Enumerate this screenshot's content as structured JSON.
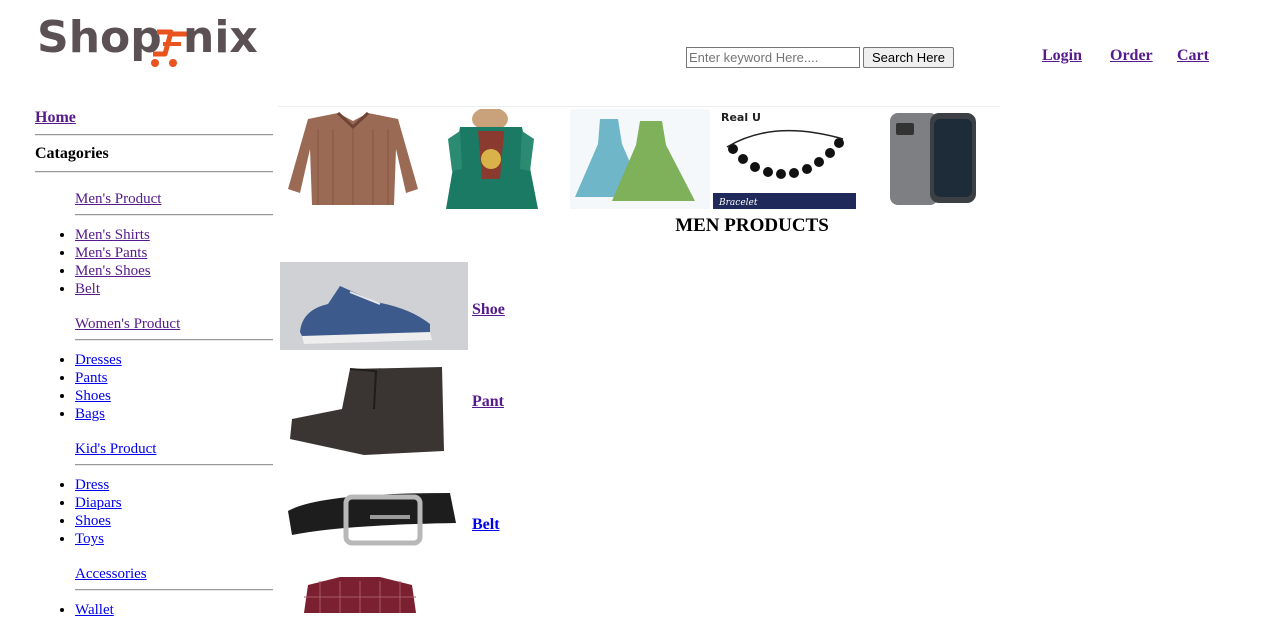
{
  "header": {
    "logo_text": "Shop nix",
    "search": {
      "placeholder": "Enter keyword Here....",
      "button_label": "Search Here"
    },
    "nav": {
      "login": "Login",
      "order": "Order",
      "cart": "Cart"
    }
  },
  "sidebar": {
    "home": "Home",
    "categories_heading": "Catagories",
    "groups": [
      {
        "title": "Men's Product",
        "items": [
          "Men's Shirts",
          "Men's Pants",
          "Men's Shoes",
          "Belt"
        ]
      },
      {
        "title": "Women's Product",
        "items": [
          "Dresses",
          "Pants",
          "Shoes",
          "Bags"
        ]
      },
      {
        "title": "Kid's Product",
        "items": [
          "Dress",
          "Diapars",
          "Shoes",
          "Toys"
        ]
      },
      {
        "title": "Accessories",
        "items": [
          "Wallet"
        ]
      }
    ]
  },
  "banner": {
    "bracelet_brand": "Real U",
    "bracelet_caption": "Bracelet"
  },
  "main": {
    "section_title": "MEN PRODUCTS",
    "products": [
      {
        "label": "Shoe"
      },
      {
        "label": "Pant"
      },
      {
        "label": "Belt"
      }
    ]
  },
  "colors": {
    "logo_gray": "#5b5053",
    "logo_orange": "#e8531e",
    "link_visited": "#551a8b",
    "link": "#0000ee"
  }
}
